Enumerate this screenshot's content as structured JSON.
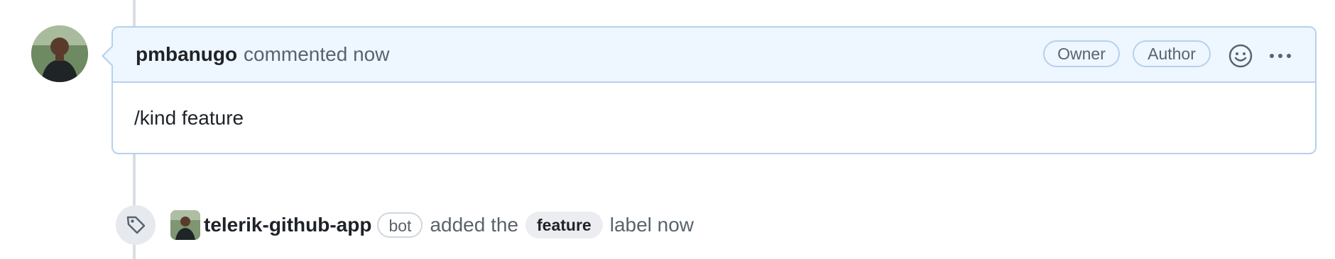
{
  "comment": {
    "author": "pmbanugo",
    "meta": "commented now",
    "badges": [
      "Owner",
      "Author"
    ],
    "body": "/kind feature",
    "icons": {
      "avatar": "user-avatar",
      "reaction": "smiley-icon",
      "more": "kebab-horizontal-icon"
    }
  },
  "event": {
    "icon": "tag-icon",
    "actor": "telerik-github-app",
    "actor_badge": "bot",
    "text_before": "added the",
    "label": "feature",
    "text_after": "label now"
  },
  "colors": {
    "header_bg": "#eef6ff",
    "border": "#b6d1ee",
    "muted_text": "#59636e",
    "timeline": "#d8dee4"
  }
}
